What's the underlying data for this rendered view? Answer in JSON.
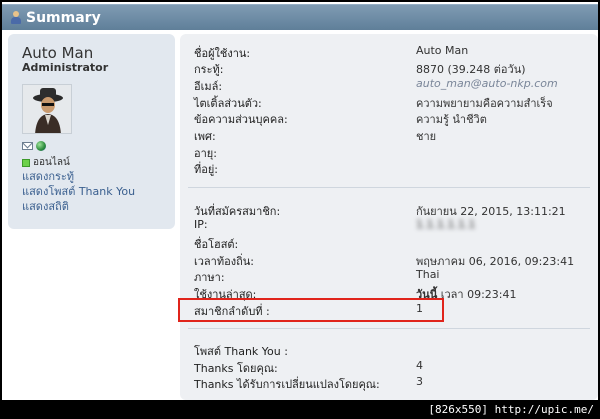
{
  "header": {
    "title": "Summary"
  },
  "profile": {
    "username": "Auto Man",
    "rank": "Administrator",
    "online_label": "ออนไลน์",
    "links": [
      "แสดงกระทู้",
      "แสดงโพสต์ Thank You",
      "แสดงสถิติ"
    ]
  },
  "details": {
    "section1": [
      {
        "label": "ชื่อผู้ใช้งาน:",
        "value": "Auto Man"
      },
      {
        "label": "กระทู้:",
        "value": "8870 (39.248 ต่อวัน)"
      },
      {
        "label": "อีเมล์:",
        "value": "auto_man@auto-nkp.com"
      },
      {
        "label": "ไตเติ้ลส่วนตัว:",
        "value": "ความพยายามคือความสำเร็จ"
      },
      {
        "label": "ข้อความส่วนบุคคล:",
        "value": "ความรู้ นำชีวิต"
      },
      {
        "label": "เพศ:",
        "value": "ชาย"
      },
      {
        "label": "อายุ:",
        "value": ""
      },
      {
        "label": "ที่อยู่:",
        "value": ""
      }
    ],
    "section2": [
      {
        "label": "วันที่สมัครสมาชิก:",
        "value": "กันยายน 22, 2015, 13:11:21"
      },
      {
        "label": "IP:",
        "value": "1.1.1.1.1.1"
      },
      {
        "label": "ชื่อโฮสต์:",
        "value": ""
      },
      {
        "label": "เวลาท้องถิ่น:",
        "value": "พฤษภาคม 06, 2016, 09:23:41"
      },
      {
        "label": "ภาษา:",
        "value": "Thai"
      },
      {
        "label": "ใช้งานล่าสุด:",
        "value_prefix": "วันนี้",
        "value": " เวลา 09:23:41"
      },
      {
        "label": "สมาชิกลำดับที่ :",
        "value": "1"
      }
    ],
    "section3": [
      {
        "label": "โพสต์ Thank You :",
        "value": ""
      },
      {
        "label": "Thanks โดยคุณ:",
        "value": "4"
      },
      {
        "label": "Thanks ได้รับการเปลี่ยนแปลงโดยคุณ:",
        "value": "3"
      }
    ]
  },
  "footer": {
    "text": "[826x550] http://upic.me/"
  },
  "colors": {
    "header_bar": "#6a88a2",
    "highlight": "#e0241b",
    "link": "#3a5f8f"
  }
}
